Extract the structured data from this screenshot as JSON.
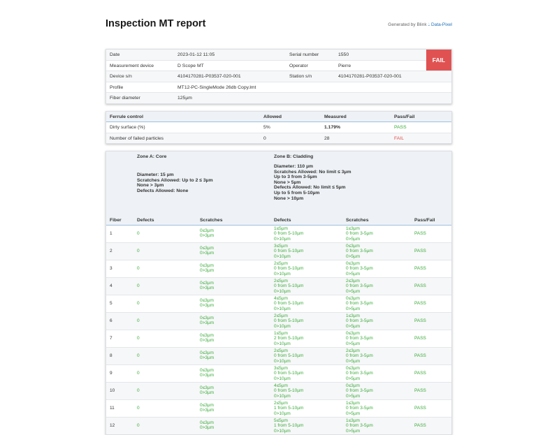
{
  "header": {
    "title": "Inspection MT report",
    "generated_by": "Generated by Blink",
    "brand": "Data-Pixel"
  },
  "overall_result": "FAIL",
  "meta": {
    "rows": [
      {
        "label1": "Date",
        "value1": "2023-01-12 11:05",
        "label2": "Serial number",
        "value2": "1550"
      },
      {
        "label1": "Measurement device",
        "value1": "D Scope MT",
        "label2": "Operator",
        "value2": "Pierre"
      },
      {
        "label1": "Device s/n",
        "value1": "4104170281-P03537-020-001",
        "label2": "Station s/n",
        "value2": "4104170281-P03537-020-001"
      },
      {
        "label1": "Profile",
        "value1": "MT12-PC-SingleMode 26db Copy.lmt",
        "label2": "",
        "value2": ""
      },
      {
        "label1": "Fiber diameter",
        "value1": "125µm",
        "label2": "",
        "value2": ""
      }
    ]
  },
  "ferrule": {
    "headers": [
      "Ferrule control",
      "Allowed",
      "Measured",
      "Pass/Fail"
    ],
    "rows": [
      {
        "name": "Dirty surface (%)",
        "allowed": "5%",
        "measured": "1.179%",
        "result": "PASS"
      },
      {
        "name": "Number of failed particles",
        "allowed": "0",
        "measured": "28",
        "result": "FAIL"
      }
    ]
  },
  "zones": {
    "a": {
      "title": "Zone A: Core",
      "lines": [
        "Diameter: 15 µm",
        "Scratches Allowed: Up to 2 ≤ 3µm",
        "None > 3µm",
        "Defects Allowed: None"
      ]
    },
    "b": {
      "title": "Zone B: Cladding",
      "lines": [
        "Diameter: 110 µm",
        "Scratches Allowed: No limit ≤ 3µm",
        "Up to 3 from 3-5µm",
        "None > 5µm",
        "Defects Allowed: No limit ≤ 5µm",
        "Up to 5 from 5-10µm",
        "None > 10µm"
      ]
    }
  },
  "fiber_table": {
    "headers": [
      "Fiber",
      "Defects",
      "Scratches",
      "Defects",
      "Scratches",
      "Pass/Fail"
    ],
    "rows": [
      {
        "fiber": "1",
        "a_def": "0",
        "a_scr": [
          "0≤3µm",
          "0>3µm"
        ],
        "b_def": [
          "1≤5µm",
          "0 from 5-10µm",
          "0>10µm"
        ],
        "b_scr": [
          "1≤3µm",
          "0 from 3-5µm",
          "0>5µm"
        ],
        "result": "PASS"
      },
      {
        "fiber": "2",
        "a_def": "0",
        "a_scr": [
          "0≤3µm",
          "0>3µm"
        ],
        "b_def": [
          "3≤5µm",
          "0 from 5-10µm",
          "0>10µm"
        ],
        "b_scr": [
          "0≤3µm",
          "0 from 3-5µm",
          "0>5µm"
        ],
        "result": "PASS"
      },
      {
        "fiber": "3",
        "a_def": "0",
        "a_scr": [
          "0≤3µm",
          "0>3µm"
        ],
        "b_def": [
          "2≤5µm",
          "0 from 5-10µm",
          "0>10µm"
        ],
        "b_scr": [
          "0≤3µm",
          "0 from 3-5µm",
          "0>5µm"
        ],
        "result": "PASS"
      },
      {
        "fiber": "4",
        "a_def": "0",
        "a_scr": [
          "0≤3µm",
          "0>3µm"
        ],
        "b_def": [
          "2≤5µm",
          "0 from 5-10µm",
          "0>10µm"
        ],
        "b_scr": [
          "2≤3µm",
          "0 from 3-5µm",
          "0>5µm"
        ],
        "result": "PASS"
      },
      {
        "fiber": "5",
        "a_def": "0",
        "a_scr": [
          "0≤3µm",
          "0>3µm"
        ],
        "b_def": [
          "4≤5µm",
          "0 from 5-10µm",
          "0>10µm"
        ],
        "b_scr": [
          "0≤3µm",
          "0 from 3-5µm",
          "0>5µm"
        ],
        "result": "PASS"
      },
      {
        "fiber": "6",
        "a_def": "0",
        "a_scr": [
          "0≤3µm",
          "0>3µm"
        ],
        "b_def": [
          "2≤5µm",
          "0 from 5-10µm",
          "0>10µm"
        ],
        "b_scr": [
          "1≤3µm",
          "0 from 3-5µm",
          "0>5µm"
        ],
        "result": "PASS"
      },
      {
        "fiber": "7",
        "a_def": "0",
        "a_scr": [
          "0≤3µm",
          "0>3µm"
        ],
        "b_def": [
          "1≤5µm",
          "2 from 5-10µm",
          "0>10µm"
        ],
        "b_scr": [
          "0≤3µm",
          "0 from 3-5µm",
          "0>5µm"
        ],
        "result": "PASS"
      },
      {
        "fiber": "8",
        "a_def": "0",
        "a_scr": [
          "0≤3µm",
          "0>3µm"
        ],
        "b_def": [
          "2≤5µm",
          "0 from 5-10µm",
          "0>10µm"
        ],
        "b_scr": [
          "2≤3µm",
          "0 from 3-5µm",
          "0>5µm"
        ],
        "result": "PASS"
      },
      {
        "fiber": "9",
        "a_def": "0",
        "a_scr": [
          "0≤3µm",
          "0>3µm"
        ],
        "b_def": [
          "3≤5µm",
          "0 from 5-10µm",
          "0>10µm"
        ],
        "b_scr": [
          "0≤3µm",
          "0 from 3-5µm",
          "0>5µm"
        ],
        "result": "PASS"
      },
      {
        "fiber": "10",
        "a_def": "0",
        "a_scr": [
          "0≤3µm",
          "0>3µm"
        ],
        "b_def": [
          "4≤5µm",
          "0 from 5-10µm",
          "0>10µm"
        ],
        "b_scr": [
          "0≤3µm",
          "0 from 3-5µm",
          "0>5µm"
        ],
        "result": "PASS"
      },
      {
        "fiber": "11",
        "a_def": "0",
        "a_scr": [
          "0≤3µm",
          "0>3µm"
        ],
        "b_def": [
          "2≤5µm",
          "1 from 5-10µm",
          "0>10µm"
        ],
        "b_scr": [
          "1≤3µm",
          "0 from 3-5µm",
          "0>5µm"
        ],
        "result": "PASS"
      },
      {
        "fiber": "12",
        "a_def": "0",
        "a_scr": [
          "0≤3µm",
          "0>3µm"
        ],
        "b_def": [
          "5≤5µm",
          "1 from 5-10µm",
          "0>10µm"
        ],
        "b_scr": [
          "1≤3µm",
          "0 from 3-5µm",
          "0>5µm"
        ],
        "result": "PASS"
      }
    ]
  },
  "colors": {
    "pass": "#3aaa3a",
    "fail": "#e05252",
    "accent": "#1e6fb8"
  }
}
